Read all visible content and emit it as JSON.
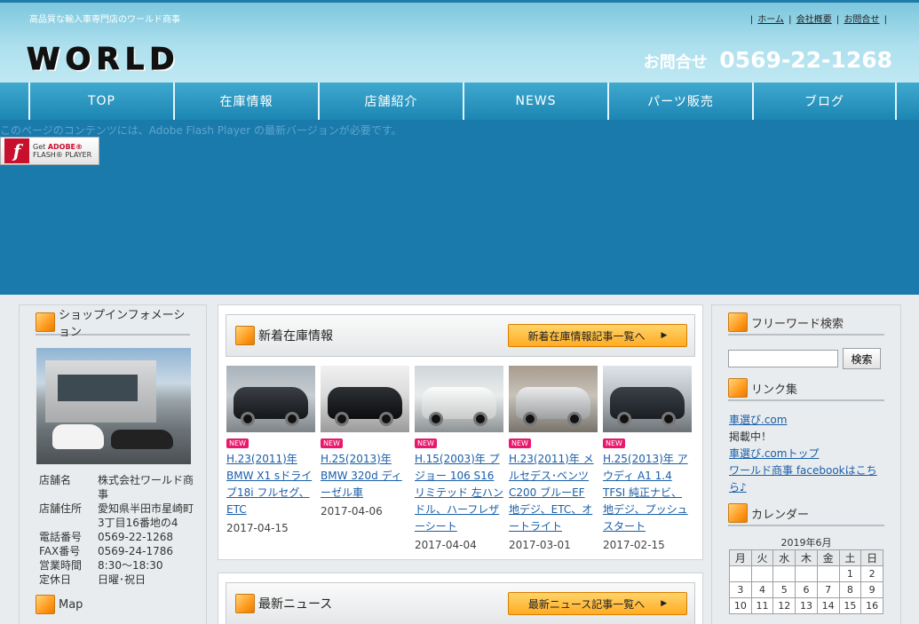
{
  "header": {
    "tagline": "高品質な輸入車専門店のワールド商事",
    "toplinks": [
      "ホーム",
      "会社概要",
      "お問合せ"
    ],
    "logo": "WORLD",
    "contact_label": "お問合せ",
    "contact_tel": "0569-22-1268"
  },
  "nav": [
    "TOP",
    "在庫情報",
    "店舗紹介",
    "NEWS",
    "パーツ販売",
    "ブログ"
  ],
  "flash": {
    "message": "このページのコンテンツには、Adobe Flash Player の最新バージョンが必要です。",
    "button_line1_brand": "ADOBE®",
    "button_line1_prefix": "Get ",
    "button_line2": "FLASH® PLAYER"
  },
  "shop": {
    "heading": "ショップインフォメーション",
    "rows": [
      {
        "k": "店舗名",
        "v": "株式会社ワールド商事"
      },
      {
        "k": "店舗住所",
        "v": "愛知県半田市星崎町3丁目16番地の4"
      },
      {
        "k": "電話番号",
        "v": "0569-22-1268"
      },
      {
        "k": "FAX番号",
        "v": "0569-24-1786"
      },
      {
        "k": "営業時間",
        "v": "8:30～18:30"
      },
      {
        "k": "定休日",
        "v": "日曜･祝日"
      }
    ],
    "map_heading": "Map"
  },
  "stock": {
    "heading": "新着在庫情報",
    "more": "新着在庫情報記事一覧へ",
    "badge": "NEW",
    "items": [
      {
        "title": "H.23(2011)年 BMW X1 sドライブ18i フルセグ、ETC",
        "date": "2017-04-15"
      },
      {
        "title": "H.25(2013)年 BMW 320d ディーゼル車",
        "date": "2017-04-06"
      },
      {
        "title": "H.15(2003)年 プジョー 106 S16リミテッド 左ハンドル、ハーフレザーシート",
        "date": "2017-04-04"
      },
      {
        "title": "H.23(2011)年 メルセデス･ベンツ C200 ブルーEF 地デジ、ETC、オートライト",
        "date": "2017-03-01"
      },
      {
        "title": "H.25(2013)年 アウディ A1 1.4 TFSI 純正ナビ、地デジ、プッシュスタート",
        "date": "2017-02-15"
      }
    ]
  },
  "news": {
    "heading": "最新ニュース",
    "more": "最新ニュース記事一覧へ"
  },
  "search": {
    "heading": "フリーワード検索",
    "button": "検索",
    "value": ""
  },
  "links": {
    "heading": "リンク集",
    "items": [
      {
        "text": "車選び.com",
        "link": true
      },
      {
        "text": "掲載中！",
        "link": false
      },
      {
        "text": "車選び.comトップ",
        "link": true
      },
      {
        "text": "ワールド商事 facebookはこちら♪",
        "link": true
      }
    ]
  },
  "calendar": {
    "heading": "カレンダー",
    "title": "2019年6月",
    "dow": [
      "月",
      "火",
      "水",
      "木",
      "金",
      "土",
      "日"
    ],
    "weeks": [
      [
        "",
        "",
        "",
        "",
        "",
        "1",
        "2"
      ],
      [
        "3",
        "4",
        "5",
        "6",
        "7",
        "8",
        "9"
      ],
      [
        "10",
        "11",
        "12",
        "13",
        "14",
        "15",
        "16"
      ]
    ]
  }
}
